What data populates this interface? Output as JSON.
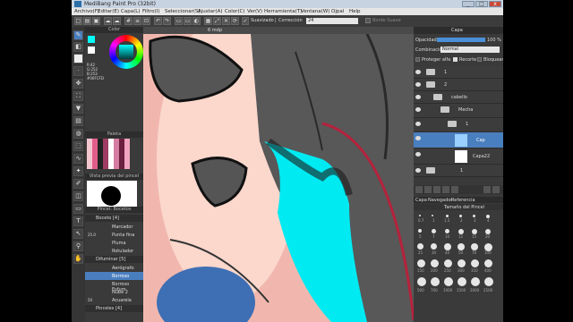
{
  "titlebar": {
    "title": "MediBang Paint Pro (32bit)",
    "minimize": "_",
    "maximize": "□",
    "close": "x"
  },
  "menu": [
    "Archivo(F)",
    "Editar(E)",
    "Capa(L)",
    "Filtro(I)",
    "Seleccionar(S)",
    "Ajustar(A)",
    "Color(C)",
    "Ver(V)",
    "Herramienta(T)",
    "Ventana(W)",
    "Ojpal",
    "Help"
  ],
  "toolbar": {
    "smoothing_label": "Suavizado",
    "correction_label": "Corrección",
    "correction_value": "24",
    "border_label": "Borde Suave"
  },
  "color_panel": {
    "header": "Color",
    "values": [
      "R:42",
      "G:252",
      "B:253",
      "#00FCFD"
    ]
  },
  "palette_panel": {
    "header": "Paleta"
  },
  "brush_preview": {
    "header": "Vista previa del pincel"
  },
  "brush_panel": {
    "header": "Pincel: Bocetos",
    "group1": {
      "label": "Boceto [4]",
      "items": [
        {
          "size": "",
          "name": "Marcador"
        },
        {
          "size": "25.0",
          "name": "Punta fina"
        },
        {
          "size": "",
          "name": "Pluma"
        },
        {
          "size": "",
          "name": "Rotulador"
        }
      ]
    },
    "group2": {
      "label": "Difuminar [5]",
      "items": [
        {
          "size": "",
          "name": "Aerógrafo"
        },
        {
          "size": "",
          "name": "Borroso"
        },
        {
          "size": "",
          "name": "Borroso Esfum"
        },
        {
          "size": "",
          "name": "Nube 2"
        },
        {
          "size": "50",
          "name": "Acuarela"
        }
      ]
    },
    "group3": {
      "label": "Pinceles [4]"
    }
  },
  "canvas": {
    "tab_label": "6 mdp",
    "status_left": "",
    "status_right": ""
  },
  "layer_panel": {
    "header": "Capa",
    "opacity_label": "Opacidad",
    "opacity_value": "100 %",
    "blend_label": "Combinación",
    "blend_value": "Normal",
    "protect_alpha": "Proteger alfa",
    "clip": "Recorte",
    "lock": "Bloquear",
    "layers": [
      {
        "name": "1",
        "indent": 0,
        "type": "folder"
      },
      {
        "name": "2",
        "indent": 0,
        "type": "folder"
      },
      {
        "name": "cabello",
        "indent": 1,
        "type": "folder"
      },
      {
        "name": "Mecha",
        "indent": 2,
        "type": "folder"
      },
      {
        "name": "1",
        "indent": 3,
        "type": "folder"
      },
      {
        "name": "Cap",
        "indent": 4,
        "type": "layer"
      },
      {
        "name": "Capa22",
        "indent": 4,
        "type": "layer"
      },
      {
        "name": "1",
        "indent": 0,
        "type": "folder"
      }
    ]
  },
  "brush_size_panel": {
    "tabs": [
      "Capa",
      "Navegador",
      "Referencia"
    ],
    "header": "Tamaño del Pincel",
    "sizes": [
      "0.7",
      "1",
      "1.5",
      "2",
      "3",
      "4",
      "5",
      "7",
      "10",
      "12",
      "15",
      "20",
      "25",
      "30",
      "40",
      "50",
      "70",
      "100",
      "150",
      "200",
      "250",
      "300",
      "350",
      "400",
      "500",
      "700",
      "1000",
      "1500",
      "2000",
      "2500"
    ]
  },
  "colors": {
    "accent": "#00fcfd",
    "panel": "#3a3a3a",
    "selected": "#4a7fbf"
  }
}
